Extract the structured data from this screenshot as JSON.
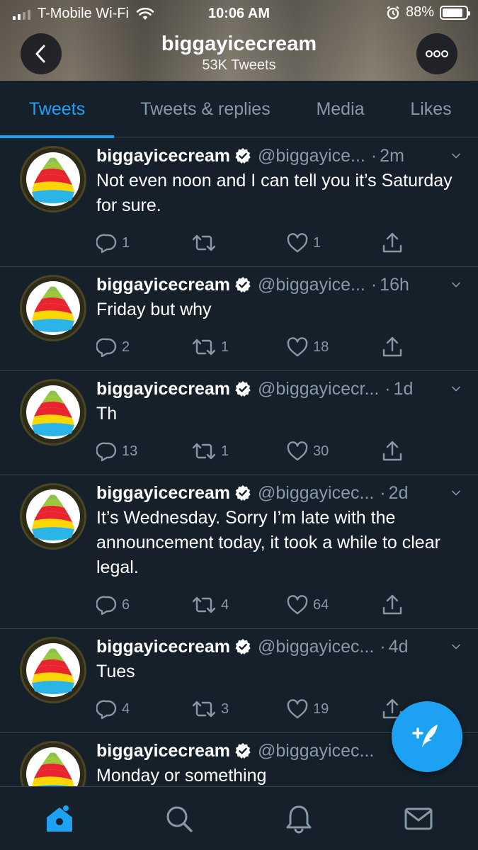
{
  "status_bar": {
    "carrier": "T-Mobile Wi-Fi",
    "time": "10:06 AM",
    "battery": "88%",
    "battery_level": 0.88
  },
  "header": {
    "title": "biggayicecream",
    "subtitle": "53K Tweets"
  },
  "tabs": [
    {
      "label": "Tweets",
      "active": true
    },
    {
      "label": "Tweets & replies",
      "active": false
    },
    {
      "label": "Media",
      "active": false
    },
    {
      "label": "Likes",
      "active": false
    }
  ],
  "tweets": [
    {
      "name": "biggayicecream",
      "handle": "@biggayice...",
      "dot": "·",
      "time": "2m",
      "text": "Not even noon and I can tell you it’s Saturday for sure.",
      "replies": "1",
      "retweets": "",
      "likes": "1"
    },
    {
      "name": "biggayicecream",
      "handle": "@biggayice...",
      "dot": "·",
      "time": "16h",
      "text": "Friday but why",
      "replies": "2",
      "retweets": "1",
      "likes": "18"
    },
    {
      "name": "biggayicecream",
      "handle": "@biggayicecr...",
      "dot": "·",
      "time": "1d",
      "text": "Th",
      "replies": "13",
      "retweets": "1",
      "likes": "30"
    },
    {
      "name": "biggayicecream",
      "handle": "@biggayicec...",
      "dot": "·",
      "time": "2d",
      "text": "It’s Wednesday. Sorry I’m late with the announcement today, it took a while to clear legal.",
      "replies": "6",
      "retweets": "4",
      "likes": "64"
    },
    {
      "name": "biggayicecream",
      "handle": "@biggayicec...",
      "dot": "·",
      "time": "4d",
      "text": "Tues",
      "replies": "4",
      "retweets": "3",
      "likes": "19"
    },
    {
      "name": "biggayicecream",
      "handle": "@biggayicec...",
      "dot": "",
      "time": "",
      "text": "Monday or something",
      "replies": "",
      "retweets": "",
      "likes": ""
    }
  ],
  "icons": {
    "avatar": "rainbow-soft-serve-icon",
    "compose": "compose-tweet-icon",
    "nav": [
      "home-icon",
      "search-icon",
      "notifications-bell-icon",
      "messages-envelope-icon"
    ]
  },
  "colors": {
    "accent": "#1da1f2",
    "background": "#15202b",
    "muted": "#8899a6",
    "divider": "#38444d"
  }
}
